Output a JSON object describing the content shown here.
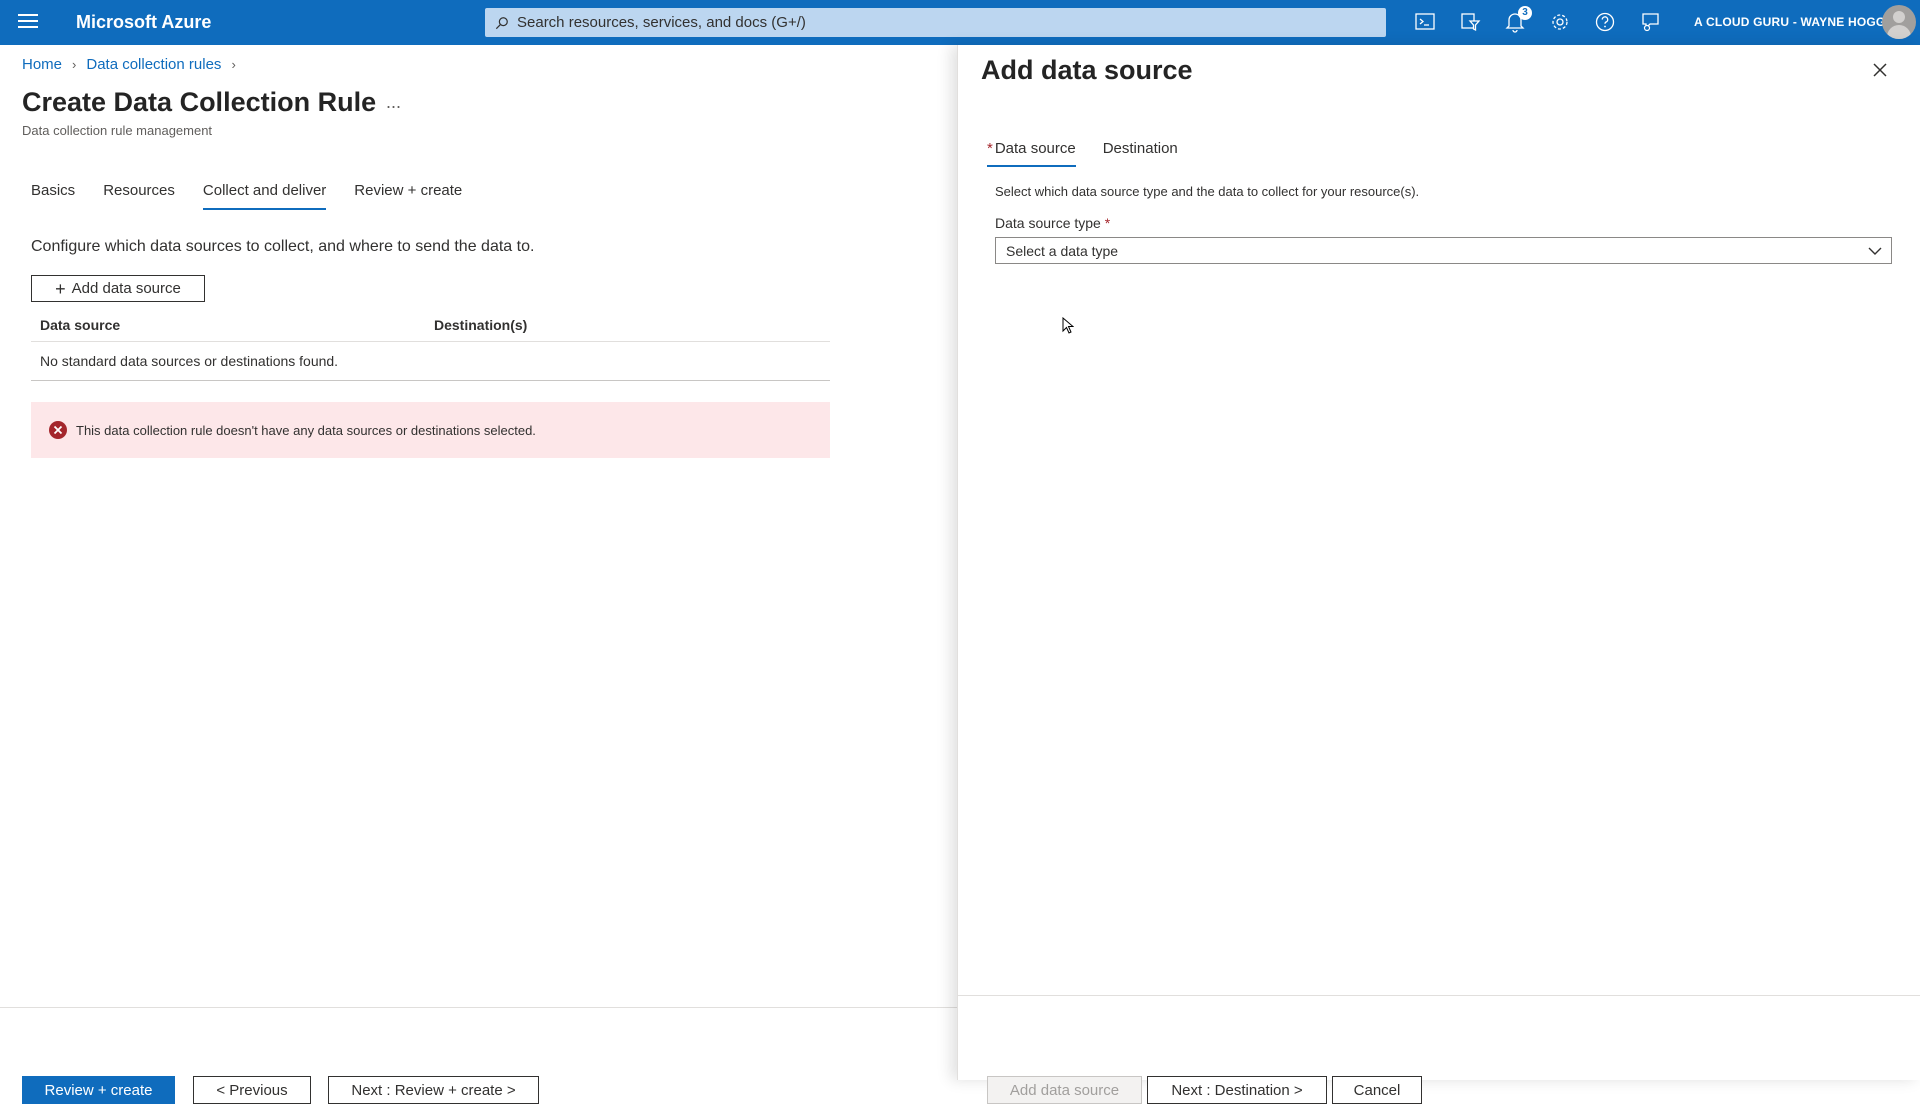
{
  "topbar": {
    "brand": "Microsoft Azure",
    "search_placeholder": "Search resources, services, and docs (G+/)",
    "notification_count": "3",
    "account": "A CLOUD GURU - WAYNE HOGG...",
    "icons": [
      "cloud-shell-icon",
      "directory-filter-icon",
      "notifications-icon",
      "settings-icon",
      "help-icon",
      "feedback-icon"
    ]
  },
  "breadcrumb": {
    "home": "Home",
    "data_collection_rules": "Data collection rules"
  },
  "page": {
    "title": "Create Data Collection Rule",
    "more": "...",
    "subtitle": "Data collection rule management",
    "tabs": [
      "Basics",
      "Resources",
      "Collect and deliver",
      "Review + create"
    ],
    "active_tab": "Collect and deliver",
    "configure_text": "Configure which data sources to collect, and where to send the data to.",
    "add_button": "Add data source",
    "table": {
      "headers": [
        "Data source",
        "Destination(s)"
      ],
      "empty_message": "No standard data sources or destinations found."
    },
    "error_message": "This data collection rule doesn't have any data sources or destinations selected."
  },
  "footer": {
    "review_create": "Review + create",
    "previous": "< Previous",
    "next": "Next : Review + create >"
  },
  "blade": {
    "title": "Add data source",
    "tabs": [
      "Data source",
      "Destination"
    ],
    "active_tab": "Data source",
    "description": "Select which data source type and the data to collect for your resource(s).",
    "field_label": "Data source type",
    "select_placeholder": "Select a data type",
    "footer": {
      "add": "Add data source",
      "next": "Next : Destination >",
      "cancel": "Cancel"
    }
  },
  "colors": {
    "brand_blue": "#0f6cbd",
    "error_bg": "#fde7e9",
    "error_icon": "#a4262c"
  }
}
